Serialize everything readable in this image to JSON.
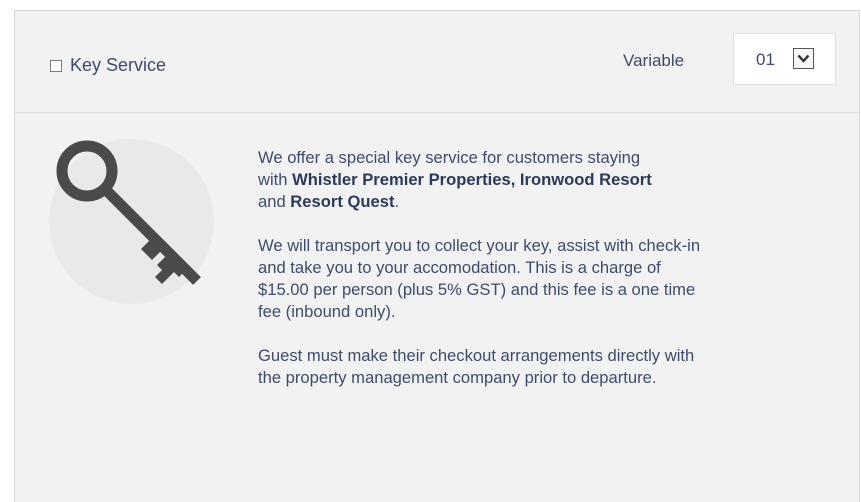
{
  "header": {
    "checkbox_label": "Key Service",
    "variable_label": "Variable",
    "select_value": "01"
  },
  "body": {
    "p1_prefix": "We offer a special key service for customers staying",
    "p1_with": "with ",
    "p1_bold1": "Whistler Premier Properties, Ironwood Resort",
    "p1_and": "and ",
    "p1_bold2": "Resort Quest",
    "p1_end": ".",
    "p2_line1": "We will transport you to collect your key, assist with check-in",
    "p2_line2": "and take you to your accomodation. This is a charge of",
    "p2_line3": "$15.00 per person (plus 5% GST) and this fee is a one time",
    "p2_line4": "fee (inbound only).",
    "p3_line1": "Guest must make their checkout arrangements directly with",
    "p3_line2": "the property management company prior to departure."
  },
  "icons": {
    "key": "key-icon",
    "dropdown": "chevron-down-icon"
  },
  "colors": {
    "text": "#3e4b6b",
    "panel_bg": "#f2f2f2",
    "icon": "#4a4a4a"
  }
}
